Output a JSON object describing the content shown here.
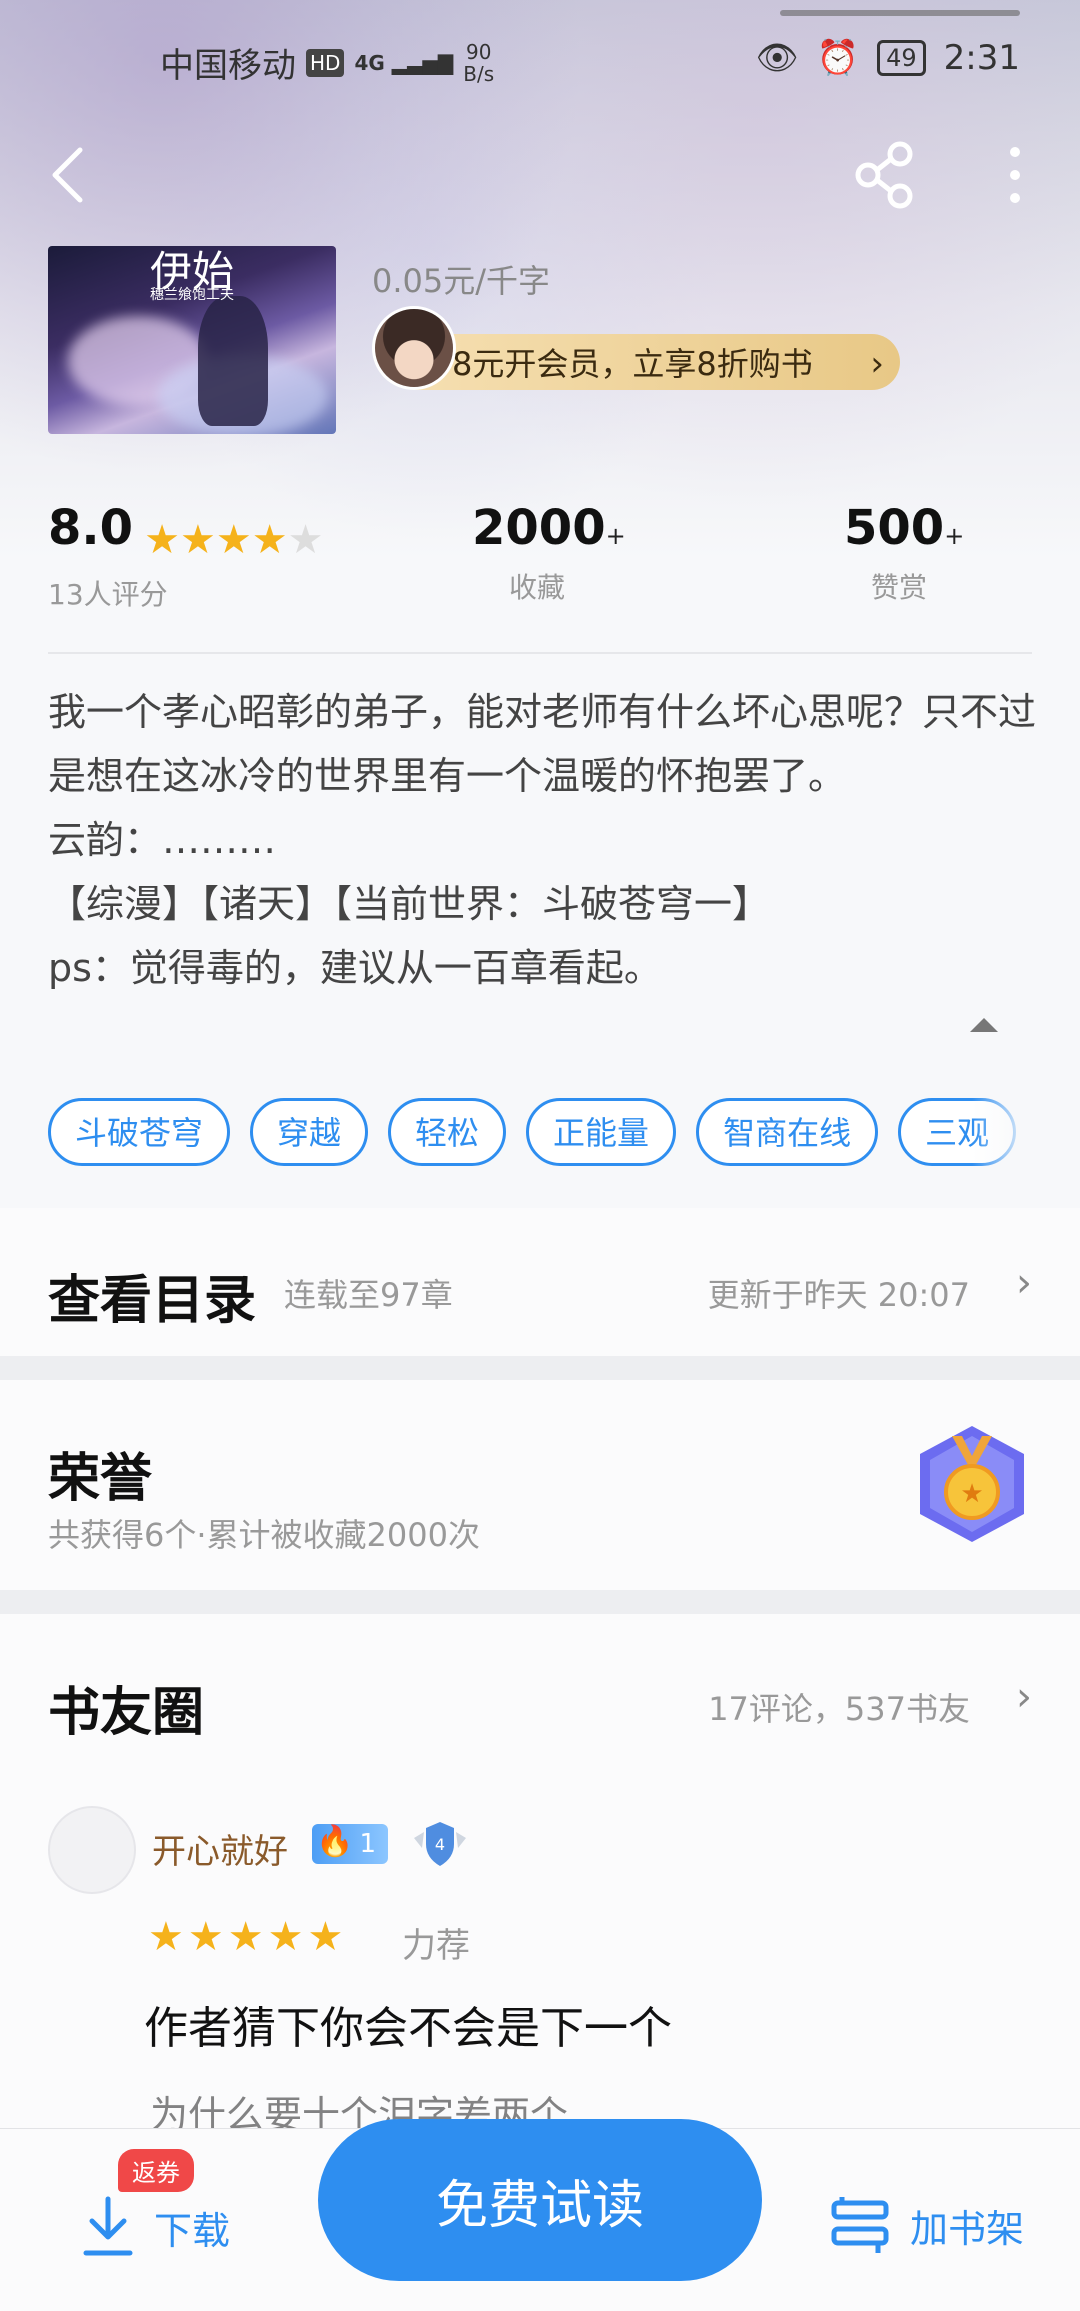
{
  "status": {
    "carrier": "中国移动",
    "hd": "HD",
    "signal_type": "4G",
    "speed_value": "90",
    "speed_unit": "B/s",
    "battery": "49",
    "time": "2:31"
  },
  "book": {
    "cover_title": "伊始",
    "cover_subtitle": "穗兰飨饱工夫",
    "price": "0.05元/千字",
    "vip_banner": "8元开会员，立享8折购书"
  },
  "stats": {
    "score": "8.0",
    "rating_stars": 4,
    "rating_count": "13人评分",
    "favorites": "2000",
    "favorites_label": "收藏",
    "rewards": "500",
    "rewards_label": "赞赏",
    "plus": "+"
  },
  "synopsis": "我一个孝心昭彰的弟子，能对老师有什么坏心思呢？只不过是想在这冰冷的世界里有一个温暖的怀抱罢了。\n云韵：………\n【综漫】【诸天】【当前世界：斗破苍穹一】\nps：觉得毒的，建议从一百章看起。",
  "tags": [
    "斗破苍穹",
    "穿越",
    "轻松",
    "正能量",
    "智商在线",
    "三观"
  ],
  "toc": {
    "title": "查看目录",
    "status": "连载至97章",
    "updated": "更新于昨天 20:07"
  },
  "honor": {
    "title": "荣誉",
    "desc": "共获得6个·累计被收藏2000次"
  },
  "circle": {
    "title": "书友圈",
    "stats": "17评论，537书友",
    "review": {
      "username": "开心就好",
      "level": "1",
      "shield_level": "4",
      "stars": 5,
      "tag": "力荐",
      "title": "作者猜下你会不会是下一个",
      "snippet": "为什么要十个泪字差两个"
    }
  },
  "bottom": {
    "download": "下载",
    "rebate": "返券",
    "read": "免费试读",
    "shelf": "加书架"
  },
  "colors": {
    "accent": "#2e8ef0",
    "star": "#f5b21b",
    "vip_gold": "#e8c886"
  }
}
